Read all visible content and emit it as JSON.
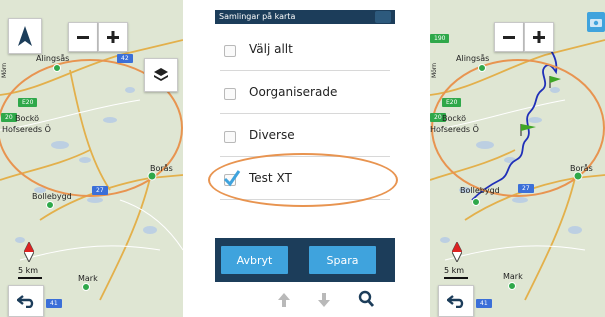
{
  "left_map": {
    "towns": [
      "Alingsås",
      "Bockö",
      "Hofsereds Ö",
      "Borås",
      "Bollebygd",
      "Mark",
      "Mörn"
    ],
    "road_badges": [
      "42",
      "E20",
      "20",
      "27",
      "41"
    ],
    "scale_label": "5 km",
    "icons": [
      "north-arrow-icon",
      "zoom-out-icon",
      "zoom-in-icon",
      "layers-icon",
      "compass-icon",
      "back-icon"
    ]
  },
  "dialog": {
    "title": "Samlingar på karta",
    "items": [
      {
        "label": "Välj allt",
        "checked": false
      },
      {
        "label": "Oorganiserade",
        "checked": false
      },
      {
        "label": "Diverse",
        "checked": false
      },
      {
        "label": "Test XT",
        "checked": true
      }
    ],
    "cancel_label": "Avbryt",
    "save_label": "Spara",
    "bottom_icons": [
      "arrow-up-icon",
      "arrow-down-icon",
      "search-icon"
    ]
  },
  "right_map": {
    "towns": [
      "Alingsås",
      "Bockö",
      "Hofsereds Ö",
      "Borås",
      "Bollebygd",
      "Mark",
      "Mörn"
    ],
    "road_badges": [
      "190",
      "E20",
      "20",
      "27",
      "41"
    ],
    "scale_label": "5 km"
  },
  "colors": {
    "title_bar": "#1c3d5a",
    "button": "#3fa3dd",
    "highlight": "#e89450",
    "track": "#1f2fb8",
    "flag": "#3fa626"
  }
}
